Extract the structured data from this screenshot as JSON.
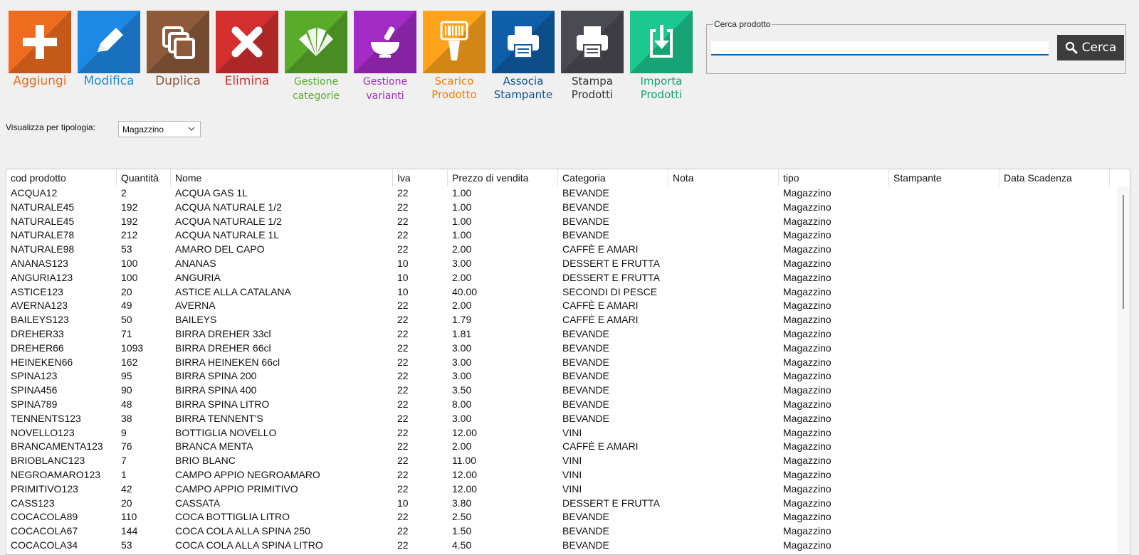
{
  "toolbar": {
    "buttons": [
      {
        "label_lines": [
          "Aggiungi"
        ],
        "icon": "plus-icon",
        "bg": "#ef6c1e",
        "color": "#ef6c1e"
      },
      {
        "label_lines": [
          "Modifica"
        ],
        "icon": "pencil-icon",
        "bg": "#1e88e5",
        "color": "#1e88e5"
      },
      {
        "label_lines": [
          "Duplica"
        ],
        "icon": "copy-icon",
        "bg": "#8d5a3a",
        "color": "#8d5a3a"
      },
      {
        "label_lines": [
          "Elimina"
        ],
        "icon": "close-icon",
        "bg": "#d32f2f",
        "color": "#d32f2f"
      },
      {
        "label_lines": [
          "Gestione",
          "categorie"
        ],
        "icon": "swatches-icon",
        "bg": "#5aab2b",
        "color": "#5aab2b"
      },
      {
        "label_lines": [
          "Gestione",
          "varianti"
        ],
        "icon": "mortar-icon",
        "bg": "#a22bc6",
        "color": "#a22bc6"
      },
      {
        "label_lines": [
          "Scarico",
          "Prodotto"
        ],
        "icon": "barcode-scanner-icon",
        "bg": "#ffa31a",
        "color": "#f57c00"
      },
      {
        "label_lines": [
          "Associa",
          "Stampante"
        ],
        "icon": "printer-icon",
        "bg": "#0f5ea8",
        "color": "#0d4f91"
      },
      {
        "label_lines": [
          "Stampa",
          "Prodotti"
        ],
        "icon": "printer-icon",
        "bg": "#4a4a52",
        "color": "#333333"
      },
      {
        "label_lines": [
          "Importa",
          "Prodotti"
        ],
        "icon": "import-icon",
        "bg": "#1bc890",
        "color": "#14a070"
      }
    ]
  },
  "search": {
    "legend": "Cerca prodotto",
    "value": "",
    "button_label": "Cerca"
  },
  "filter": {
    "label": "Visualizza per tipologia:",
    "selected": "Magazzino"
  },
  "table": {
    "columns": [
      "cod prodotto",
      "Quantità",
      "Nome",
      "Iva",
      "Prezzo di vendita",
      "Categoria",
      "Nota",
      "tipo",
      "Stampante",
      "Data Scadenza"
    ],
    "rows": [
      [
        "ACQUA12",
        "2",
        "ACQUA GAS 1L",
        "22",
        "1.00",
        "BEVANDE",
        "",
        "Magazzino",
        "",
        ""
      ],
      [
        "NATURALE45",
        "192",
        "ACQUA NATURALE 1/2",
        "22",
        "1.00",
        "BEVANDE",
        "",
        "Magazzino",
        "",
        ""
      ],
      [
        "NATURALE45",
        "192",
        "ACQUA NATURALE 1/2",
        "22",
        "1.00",
        "BEVANDE",
        "",
        "Magazzino",
        "",
        ""
      ],
      [
        "NATURALE78",
        "212",
        "ACQUA NATURALE 1L",
        "22",
        "1.00",
        "BEVANDE",
        "",
        "Magazzino",
        "",
        ""
      ],
      [
        "NATURALE98",
        "53",
        "AMARO DEL CAPO",
        "22",
        "2.00",
        "CAFFÈ E AMARI",
        "",
        "Magazzino",
        "",
        ""
      ],
      [
        "ANANAS123",
        "100",
        "ANANAS",
        "10",
        "3.00",
        "DESSERT E FRUTTA",
        "",
        "Magazzino",
        "",
        ""
      ],
      [
        "ANGURIA123",
        "100",
        "ANGURIA",
        "10",
        "2.00",
        "DESSERT E FRUTTA",
        "",
        "Magazzino",
        "",
        ""
      ],
      [
        "ASTICE123",
        "20",
        "ASTICE ALLA CATALANA",
        "10",
        "40.00",
        "SECONDI DI PESCE",
        "",
        "Magazzino",
        "",
        ""
      ],
      [
        "AVERNA123",
        "49",
        "AVERNA",
        "22",
        "2.00",
        "CAFFÈ E AMARI",
        "",
        "Magazzino",
        "",
        ""
      ],
      [
        "BAILEYS123",
        "50",
        "BAILEYS",
        "22",
        "1.79",
        "CAFFÈ E AMARI",
        "",
        "Magazzino",
        "",
        ""
      ],
      [
        "DREHER33",
        "71",
        "BIRRA DREHER 33cl",
        "22",
        "1.81",
        "BEVANDE",
        "",
        "Magazzino",
        "",
        ""
      ],
      [
        "DREHER66",
        "1093",
        "BIRRA DREHER 66cl",
        "22",
        "3.00",
        "BEVANDE",
        "",
        "Magazzino",
        "",
        ""
      ],
      [
        "HEINEKEN66",
        "162",
        "BIRRA HEINEKEN 66cl",
        "22",
        "3.00",
        "BEVANDE",
        "",
        "Magazzino",
        "",
        ""
      ],
      [
        "SPINA123",
        "95",
        "BIRRA SPINA 200",
        "22",
        "3.00",
        "BEVANDE",
        "",
        "Magazzino",
        "",
        ""
      ],
      [
        "SPINA456",
        "90",
        "BIRRA SPINA 400",
        "22",
        "3.50",
        "BEVANDE",
        "",
        "Magazzino",
        "",
        ""
      ],
      [
        "SPINA789",
        "48",
        "BIRRA SPINA LITRO",
        "22",
        "8.00",
        "BEVANDE",
        "",
        "Magazzino",
        "",
        ""
      ],
      [
        "TENNENTS123",
        "38",
        "BIRRA TENNENT'S",
        "22",
        "3.00",
        "BEVANDE",
        "",
        "Magazzino",
        "",
        ""
      ],
      [
        "NOVELLO123",
        "9",
        "BOTTIGLIA NOVELLO",
        "22",
        "12.00",
        "VINI",
        "",
        "Magazzino",
        "",
        ""
      ],
      [
        "BRANCAMENTA123",
        "76",
        "BRANCA MENTA",
        "22",
        "2.00",
        "CAFFÈ E AMARI",
        "",
        "Magazzino",
        "",
        ""
      ],
      [
        "BRIOBLANC123",
        "7",
        "BRIO BLANC",
        "22",
        "11.00",
        "VINI",
        "",
        "Magazzino",
        "",
        ""
      ],
      [
        "NEGROAMARO123",
        "1",
        "CAMPO APPIO NEGROAMARO",
        "22",
        "12.00",
        "VINI",
        "",
        "Magazzino",
        "",
        ""
      ],
      [
        "PRIMITIVO123",
        "42",
        "CAMPO APPIO PRIMITIVO",
        "22",
        "12.00",
        "VINI",
        "",
        "Magazzino",
        "",
        ""
      ],
      [
        "CASS123",
        "20",
        "CASSATA",
        "10",
        "3.80",
        "DESSERT E FRUTTA",
        "",
        "Magazzino",
        "",
        ""
      ],
      [
        "COCACOLA89",
        "110",
        "COCA BOTTIGLIA LITRO",
        "22",
        "2.50",
        "BEVANDE",
        "",
        "Magazzino",
        "",
        ""
      ],
      [
        "COCACOLA67",
        "144",
        "COCA COLA ALLA SPINA 250",
        "22",
        "1.50",
        "BEVANDE",
        "",
        "Magazzino",
        "",
        ""
      ],
      [
        "COCACOLA34",
        "53",
        "COCA COLA ALLA SPINA LITRO",
        "22",
        "4.50",
        "BEVANDE",
        "",
        "Magazzino",
        "",
        ""
      ]
    ]
  }
}
